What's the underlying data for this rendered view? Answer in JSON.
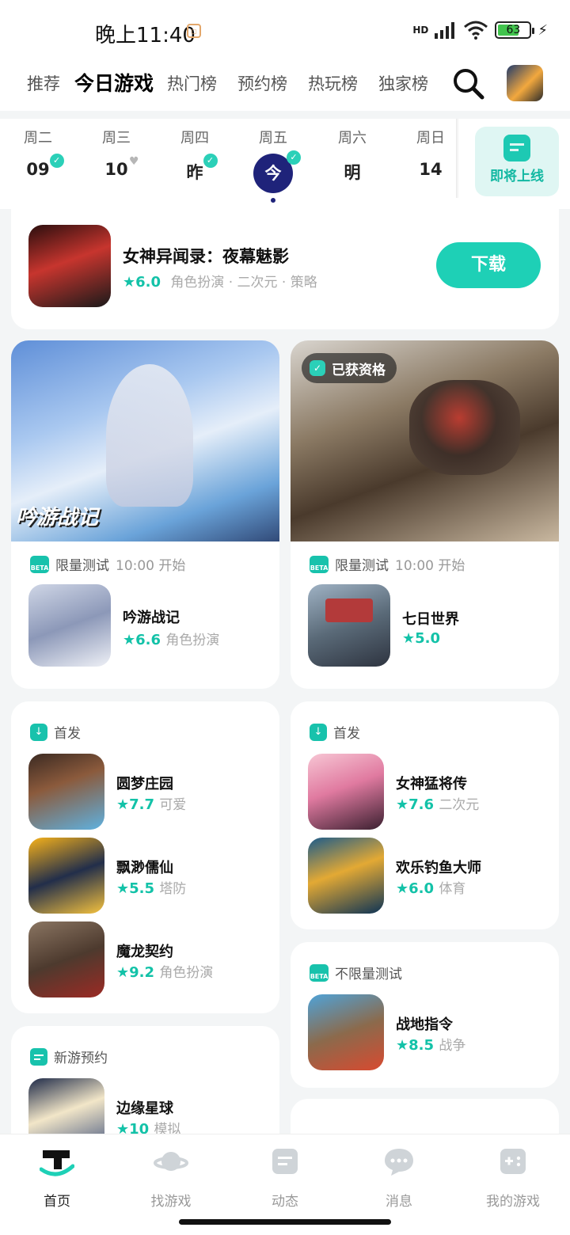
{
  "status": {
    "time": "晚上11:40",
    "network": "HD",
    "battery": "63"
  },
  "top_nav": {
    "tabs": [
      "推荐",
      "今日游戏",
      "热门榜",
      "预约榜",
      "热玩榜",
      "独家榜"
    ],
    "active_index": 1
  },
  "week": {
    "days": [
      {
        "label": "周二",
        "num": "09"
      },
      {
        "label": "周三",
        "num": "10"
      },
      {
        "label": "周四",
        "num": "昨"
      },
      {
        "label": "周五",
        "num": "今"
      },
      {
        "label": "周六",
        "num": "明"
      },
      {
        "label": "周日",
        "num": "14"
      }
    ],
    "coming_label": "即将上线"
  },
  "featured": {
    "title": "女神异闻录：夜幕魅影",
    "rating": "★6.0",
    "tags": "角色扮演 · 二次元 · 策略",
    "button": "下载"
  },
  "test_cards": [
    {
      "banner_text": "吟游战记",
      "beta_text": "限量测试",
      "time": "10:00 开始",
      "title": "吟游战记",
      "rating": "★6.6",
      "tag": "角色扮演"
    },
    {
      "badge": "已获资格",
      "beta_text": "限量测试",
      "time": "10:00 开始",
      "title": "七日世界",
      "rating": "★5.0",
      "tag": ""
    }
  ],
  "first_left": {
    "header": "首发",
    "items": [
      {
        "title": "圆梦庄园",
        "rating": "★7.7",
        "tag": "可爱"
      },
      {
        "title": "飘渺儒仙",
        "rating": "★5.5",
        "tag": "塔防"
      },
      {
        "title": "魔龙契约",
        "rating": "★9.2",
        "tag": "角色扮演"
      }
    ]
  },
  "first_right": {
    "header": "首发",
    "items": [
      {
        "title": "女神猛将传",
        "rating": "★7.6",
        "tag": "二次元"
      },
      {
        "title": "欢乐钓鱼大师",
        "rating": "★6.0",
        "tag": "体育"
      }
    ]
  },
  "unlimited": {
    "header": "不限量测试",
    "title": "战地指令",
    "rating": "★8.5",
    "tag": "战争"
  },
  "reserve": {
    "header": "新游预约",
    "title": "边缘星球",
    "rating": "★10",
    "tag": "模拟"
  },
  "bottom_nav": [
    "首页",
    "找游戏",
    "动态",
    "消息",
    "我的游戏"
  ],
  "colors": {
    "accent": "#1ed0b6",
    "today": "#1f237a"
  }
}
